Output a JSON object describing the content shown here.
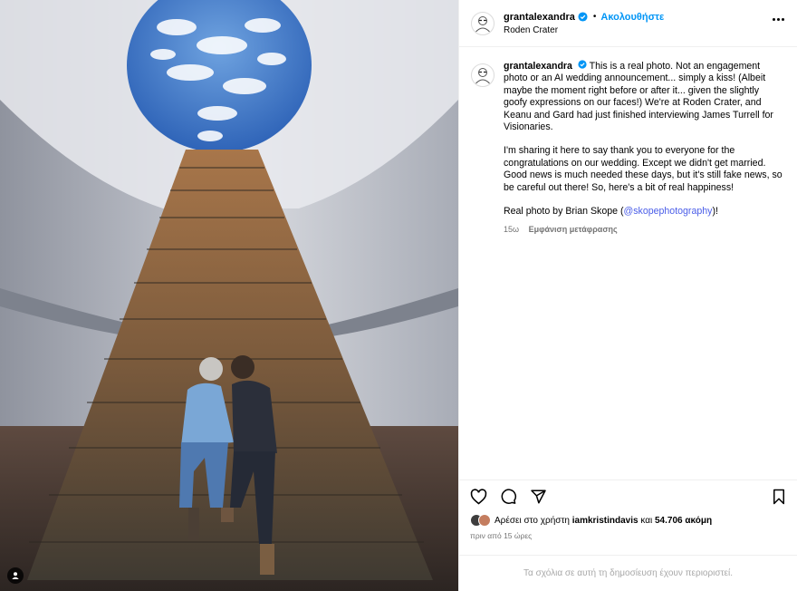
{
  "post": {
    "username": "grantalexandra",
    "follow_label": "Ακολουθήστε",
    "location": "Roden Crater",
    "photo_alt": "Couple kissing on the stairs at Roden Crater"
  },
  "caption": {
    "username": "grantalexandra",
    "paragraph1": "This is a real photo. Not an engagement photo or an AI wedding announcement... simply a kiss! (Albeit maybe the moment right before or after it... given the slightly goofy expressions on our faces!) We're at Roden Crater, and Keanu and Gard had just finished interviewing James Turrell for Visionaries.",
    "paragraph2": "I'm sharing it here to say thank you to everyone for the congratulations on our wedding. Except we didn't get married. Good news is much needed these days, but it's still fake news, so be careful out there! So, here's a bit of real happiness!",
    "credit_prefix": "Real photo by Brian Skope (",
    "credit_handle": "@skopephotography",
    "credit_suffix": ")!",
    "age": "15ω",
    "translate_label": "Εμφάνιση μετάφρασης"
  },
  "likes": {
    "prefix": "Αρέσει στο χρήστη",
    "user": "iamkristindavis",
    "middle": "και",
    "count": "54.706 ακόμη"
  },
  "timestamp": "πριν από 15 ώρες",
  "comments_restricted": "Τα σχόλια σε αυτή τη δημοσίευση έχουν περιοριστεί.",
  "icons": {
    "verified": "verified-badge-icon",
    "like": "heart-icon",
    "comment": "comment-icon",
    "share": "paper-plane-icon",
    "save": "bookmark-icon",
    "more": "more-options-icon",
    "tags": "user-tag-icon"
  },
  "colors": {
    "accent": "#0095f6",
    "verified": "#0095f6",
    "muted": "#737373",
    "border": "#efefef"
  }
}
